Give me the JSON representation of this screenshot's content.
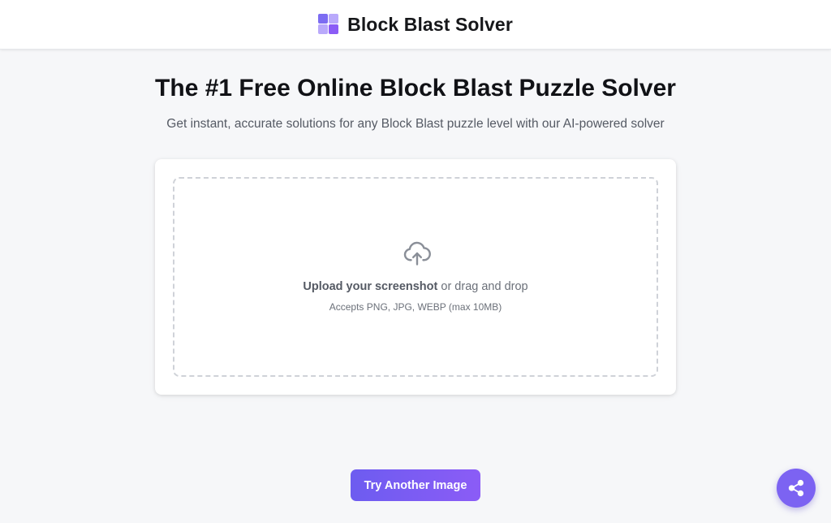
{
  "header": {
    "brand_name": "Block Blast Solver",
    "logo_icon": "blocks-logo-icon"
  },
  "hero": {
    "title": "The #1 Free Online Block Blast Puzzle Solver",
    "subtitle": "Get instant, accurate solutions for any Block Blast puzzle level with our AI-powered solver"
  },
  "upload": {
    "icon": "cloud-upload-icon",
    "action_label": "Upload your screenshot",
    "action_suffix": " or drag and drop",
    "hint": "Accepts PNG, JPG, WEBP (max 10MB)"
  },
  "actions": {
    "try_another_label": "Try Another Image",
    "share_icon": "share-icon"
  },
  "colors": {
    "accent": "#7c63f2",
    "accent_gradient_start": "#6d5cf0",
    "accent_gradient_end": "#8b5cf6",
    "background": "#f6f7f9"
  }
}
